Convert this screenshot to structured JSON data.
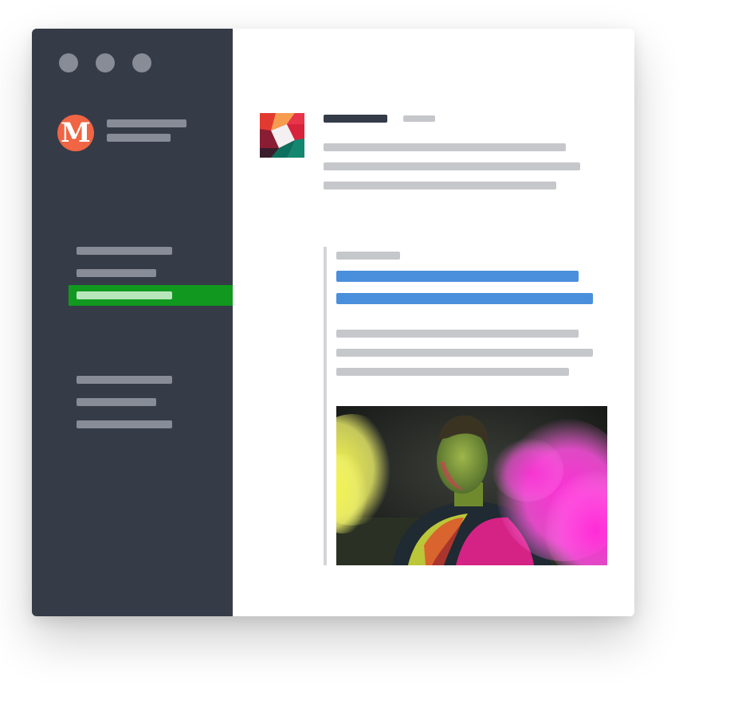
{
  "colors": {
    "sidebar_bg": "#363b48",
    "traffic_light": "#878c97",
    "sidebar_text_placeholder": "#878c97",
    "active_nav_bg": "#10991e",
    "active_nav_text": "#b8e6bb",
    "avatar_bg": "#f06543",
    "heading_placeholder": "#353b48",
    "muted_placeholder": "#c6c7cb",
    "link_placeholder": "#4a8fdb",
    "quote_rule": "#d3d4d7"
  },
  "sidebar": {
    "avatar_letter": "M",
    "traffic_lights": [
      "close",
      "minimize",
      "maximize"
    ],
    "nav_groups": [
      {
        "items": [
          "item-1",
          "item-2",
          "item-3"
        ],
        "active_index": 2
      },
      {
        "items": [
          "item-4",
          "item-5",
          "item-6"
        ]
      }
    ]
  },
  "post": {
    "avatar_icon": "colorful-tile-logo",
    "image": "holi-powder-photo"
  }
}
